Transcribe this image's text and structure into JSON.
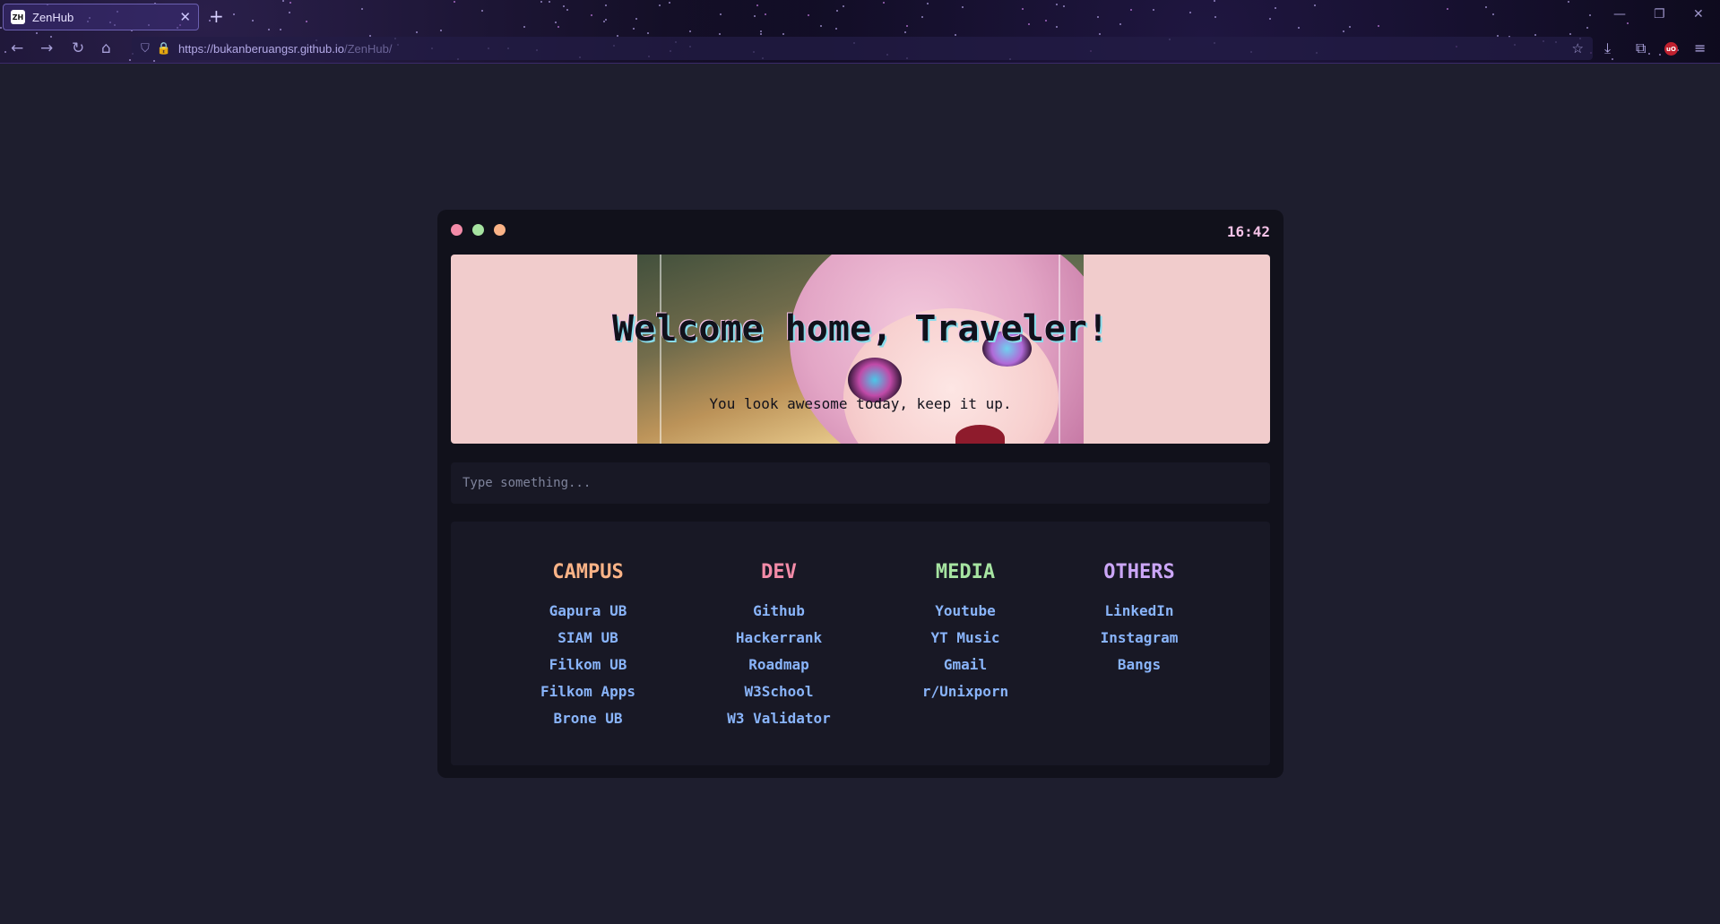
{
  "browser": {
    "tab_title": "ZenHub",
    "favicon_text": "ZH",
    "url_host": "https://bukanberuangsr.github.io",
    "url_path": "/ZenHub/",
    "ublock_badge": "uO"
  },
  "page": {
    "clock": "16:42",
    "welcome": "Welcome home, Traveler!",
    "tagline": "You look awesome today, keep it up.",
    "search_placeholder": "Type something...",
    "window_dots": [
      "#f38ba8",
      "#a6e3a1",
      "#fab387"
    ]
  },
  "columns": [
    {
      "title": "CAMPUS",
      "color": "#fab387",
      "links": [
        "Gapura UB",
        "SIAM UB",
        "Filkom UB",
        "Filkom Apps",
        "Brone UB"
      ]
    },
    {
      "title": "DEV",
      "color": "#f38ba8",
      "links": [
        "Github",
        "Hackerrank",
        "Roadmap",
        "W3School",
        "W3 Validator"
      ]
    },
    {
      "title": "MEDIA",
      "color": "#a6e3a1",
      "links": [
        "Youtube",
        "YT Music",
        "Gmail",
        "r/Unixporn"
      ]
    },
    {
      "title": "OTHERS",
      "color": "#cba6f7",
      "links": [
        "LinkedIn",
        "Instagram",
        "Bangs"
      ]
    }
  ]
}
